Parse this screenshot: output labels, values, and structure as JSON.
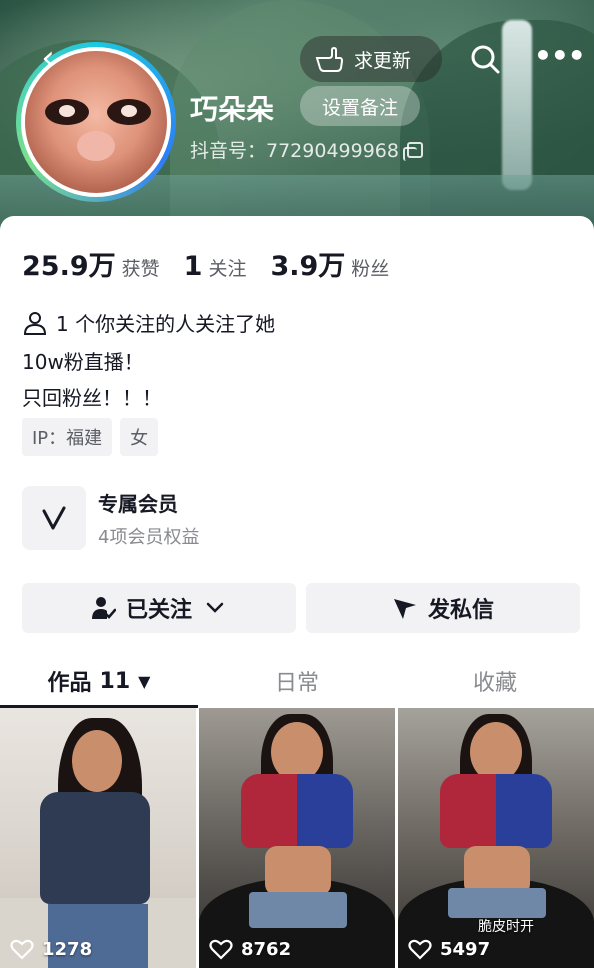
{
  "header": {
    "update_label": "求更新",
    "name": "巧朵朵",
    "remark_label": "设置备注",
    "douyin_id": "抖音号：77290499968"
  },
  "stats": [
    {
      "num": "25.9万",
      "label": "获赞"
    },
    {
      "num": "1",
      "label": "关注"
    },
    {
      "num": "3.9万",
      "label": "粉丝"
    }
  ],
  "mutual": "1 个你关注的人关注了她",
  "bio": [
    "10w粉直播！",
    "只回粉丝！！！"
  ],
  "tags": [
    "IP：福建",
    "女"
  ],
  "member": {
    "title": "专属会员",
    "subtitle": "4项会员权益"
  },
  "buttons": {
    "follow": "已关注",
    "message": "发私信"
  },
  "tabs": [
    {
      "label": "作品",
      "count": "11"
    },
    {
      "label": "日常"
    },
    {
      "label": "收藏"
    }
  ],
  "videos": [
    {
      "likes": "1278"
    },
    {
      "likes": "8762"
    },
    {
      "likes": "5497",
      "caption": "脆皮时开"
    }
  ]
}
